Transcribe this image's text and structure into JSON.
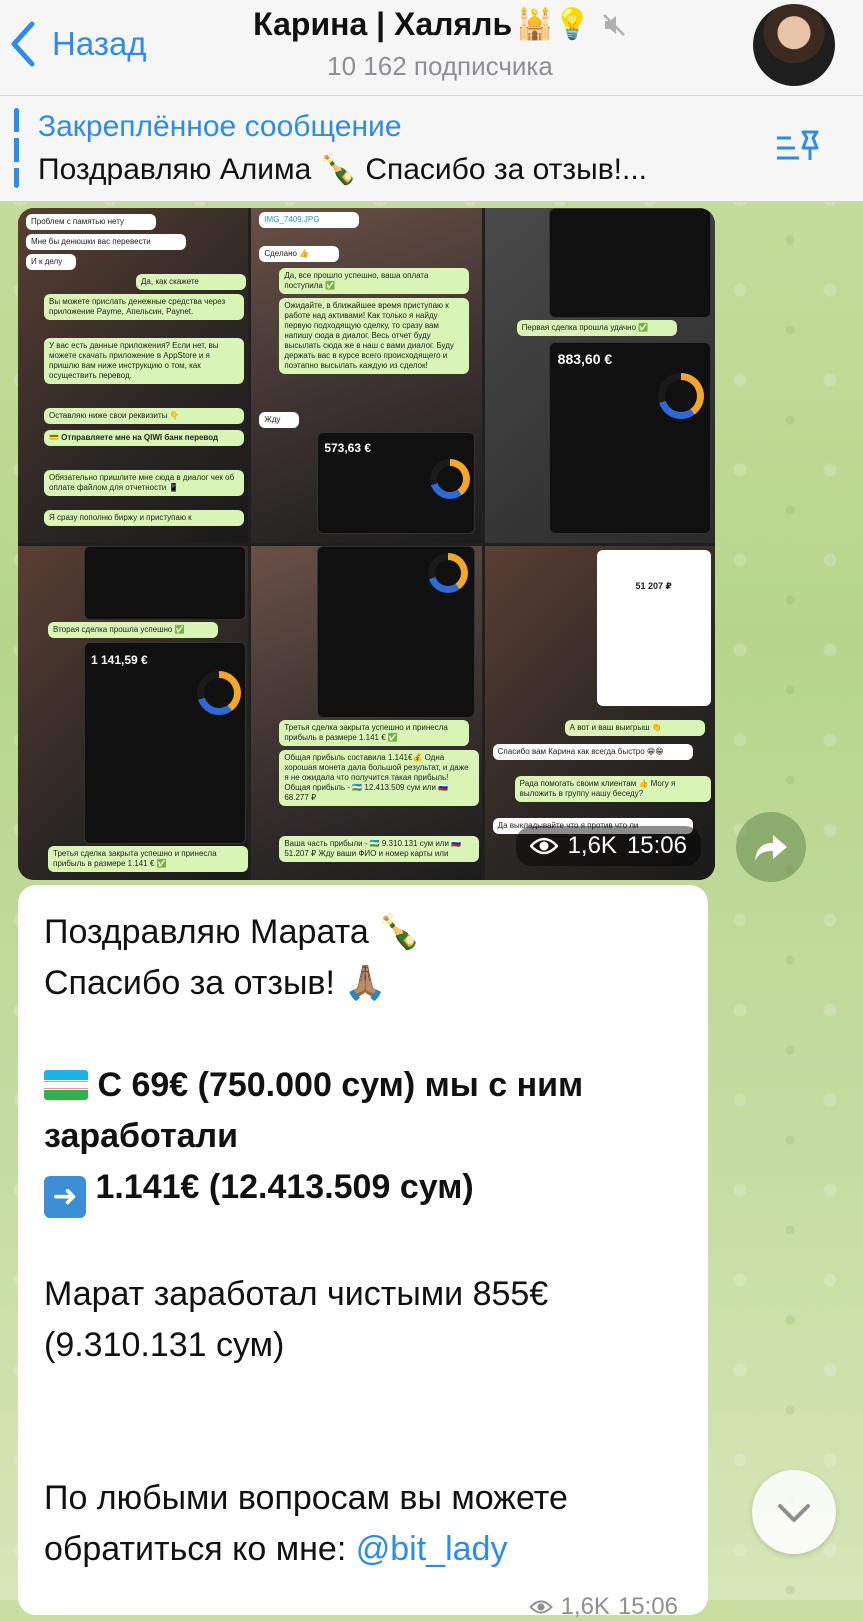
{
  "header": {
    "back_label": "Назад",
    "title": "Карина | Халяль",
    "title_emoji": "🕌💡",
    "subscribers": "10 162 подписчика"
  },
  "pinned": {
    "title": "Закреплённое сообщение",
    "text": "Поздравляю Алима 🍾 Спасибо за отзыв!..."
  },
  "media_post": {
    "views": "1,6K",
    "time": "15:06",
    "tiles": [
      {
        "messages": [
          "Проблем с памятью нету",
          "Мне бы денюшки вас перевести",
          "И к делу",
          "Да, как скажете",
          "Вы можете прислать денежные средства через приложение Payme, Апельсин, Paynet.",
          "У вас есть данные приложения? Если нет, вы можете скачать приложение в AppStore и я пришлю вам ниже инструкцию о том, как осуществить перевод.",
          "Оставляю ниже свои реквизиты 👇",
          "💳 Отправляете мне на QIWI банк перевод",
          "Обязательно пришлите мне сюда в диалог чек об оплате файлом для отчетности 📱",
          "Я сразу пополню биржу и приступаю к"
        ]
      },
      {
        "messages": [
          "IMG_7409.JPG",
          "Сделано 👍",
          "Да, все прошло успешно, ваша оплата поступила ✅",
          "Ожидайте, в ближайшее время приступаю к работе над активами! Как только я найду первую подходящую сделку, то сразу вам напишу сюда в диалог. Весь отчет буду высылать сюда же в наш с вами диалог. Буду держать вас в курсе всего происходящего и поэтапно высылать каждую из сделок!",
          "Жду"
        ],
        "amount": "573,63 €"
      },
      {
        "messages": [
          "Первая сделка прошла удачно ✅"
        ],
        "amount": "883,60 €"
      },
      {
        "messages": [
          "Вторая сделка прошла успешно ✅",
          "Третья сделка закрыта успешно и принесла прибыль в размере 1.141 € ✅"
        ],
        "amount": "1 141,59 €"
      },
      {
        "messages": [
          "Третья сделка закрыта успешно и принесла прибыль в размере 1.141 € ✅",
          "Общая прибыль составила 1.141€💰 Одна хорошая монета дала большой результат, и даже я не ожидала что получится такая прибыль! Общая прибыль - 🇺🇿 12.413.509 сум или 🇷🇺 68.277 ₽",
          "Ваша часть прибыли - 🇺🇿 9.310.131 сум или 🇷🇺 51.207 ₽ Жду ваши ФИО и номер карты или"
        ]
      },
      {
        "messages": [
          "А вот и ваш выигрыш 👏",
          "Спасибо вам Карина как всегда быстро 😁😁",
          "Рада помогать своим клиентам 👍 Могу я выложить в группу нашу беседу?",
          "Да выкладывайте что я против что ли"
        ],
        "amount": "51 207 ₽"
      }
    ]
  },
  "text_post": {
    "line1": "Поздравляю Марата 🍾",
    "line2": "Спасибо за отзыв! 🙏🏽",
    "line3": "С 69€ (750.000 сум) мы с ним заработали",
    "line4": "1.141€ (12.413.509 сум)",
    "line5": "Марат заработал чистыми 855€ (9.310.131 сум)",
    "line6_prefix": "По любыми вопросам вы можете обратиться ко мне: ",
    "link": "@bit_lady",
    "views": "1,6K",
    "time": "15:06"
  }
}
